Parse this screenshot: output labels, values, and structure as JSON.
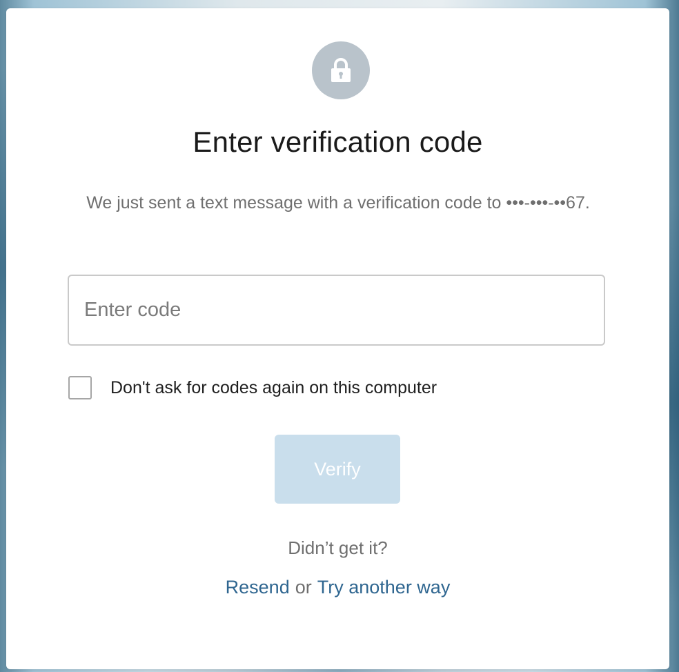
{
  "title": "Enter verification code",
  "description": "We just sent a text message with a verification code to •••-•••-••67.",
  "code_input": {
    "placeholder": "Enter code",
    "value": ""
  },
  "remember": {
    "label": "Don't ask for codes again on this computer",
    "checked": false
  },
  "verify_button": {
    "label": "Verify",
    "enabled": false
  },
  "didnt_get": "Didn’t get it?",
  "resend_link": "Resend",
  "or_text": "or",
  "try_another_link": "Try another way",
  "icons": {
    "header": "lock-icon"
  },
  "colors": {
    "link": "#2f6690",
    "verify_disabled_bg": "#c9deec",
    "icon_circle": "#b9c3cb"
  }
}
